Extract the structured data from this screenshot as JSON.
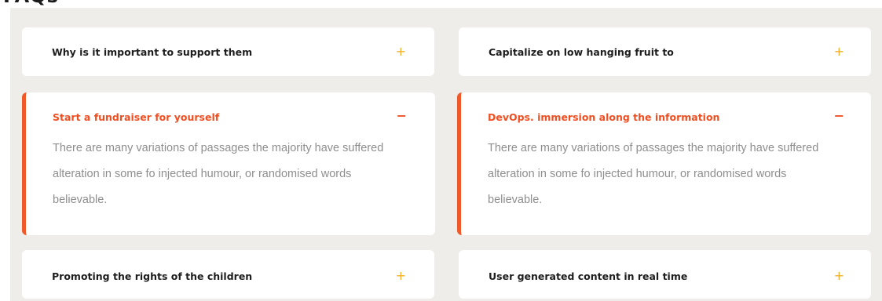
{
  "section": {
    "heading": "FAQs"
  },
  "accent_color": "#ef4f23",
  "icon_color": "#f3b02b",
  "faqs": [
    {
      "question": "Why is it important to support them",
      "icon": "plus-icon",
      "symbol": "+",
      "expanded": false
    },
    {
      "question": "Capitalize on low hanging fruit to",
      "icon": "plus-icon",
      "symbol": "+",
      "expanded": false
    },
    {
      "question": "Start a fundraiser for yourself",
      "icon": "minus-icon",
      "symbol": "−",
      "expanded": true,
      "answer": "There are many variations of passages the majority have suffered alteration in some fo injected humour, or randomised words believable."
    },
    {
      "question": "DevOps. immersion along the information",
      "icon": "minus-icon",
      "symbol": "−",
      "expanded": true,
      "answer": "There are many variations of passages the majority have suffered alteration in some fo injected humour, or randomised words believable."
    },
    {
      "question": "Promoting the rights of the children",
      "icon": "plus-icon",
      "symbol": "+",
      "expanded": false
    },
    {
      "question": "User generated content in real time",
      "icon": "plus-icon",
      "symbol": "+",
      "expanded": false
    }
  ]
}
